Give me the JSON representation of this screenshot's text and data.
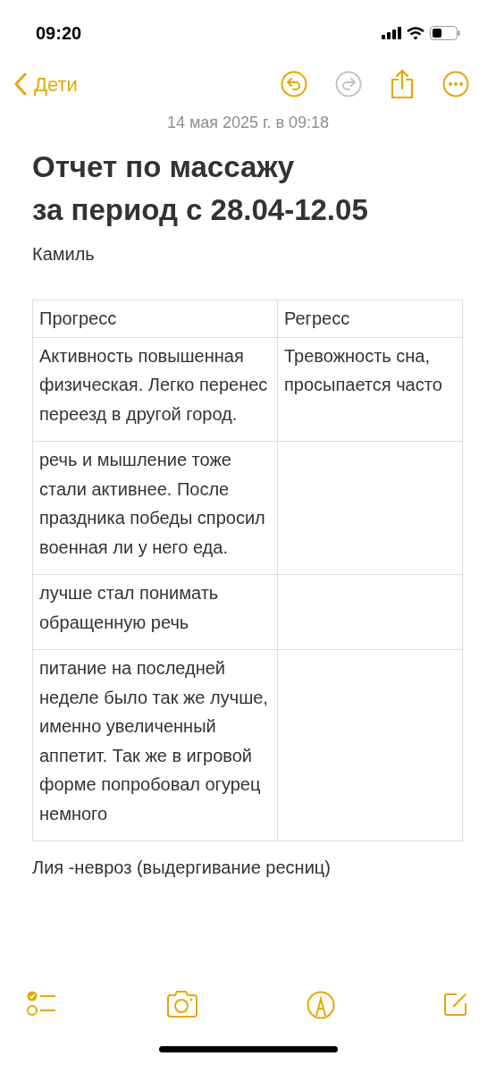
{
  "status_bar": {
    "time": "09:20"
  },
  "nav": {
    "back_label": "Дети",
    "redo_disabled": true
  },
  "note": {
    "date": "14 мая 2025 г. в 09:18",
    "title_lines": [
      "Отчет по массажу",
      "за период с 28.04-12.05"
    ],
    "subtitle": "Камиль",
    "table": {
      "columns": [
        "Прогресс",
        "Регресс"
      ],
      "rows": [
        [
          "Активность повышенная физическая. Легко перенес переезд в другой город.",
          "Тревожность сна, просыпается часто"
        ],
        [
          "речь и мышление тоже стали активнее. После праздника победы спросил военная ли у него еда.",
          ""
        ],
        [
          "лучше стал понимать обращенную речь",
          ""
        ],
        [
          "питание на последней неделе было так же лучше, именно увеличенный аппетит. Так же в игровой форме попробовал огурец немного",
          ""
        ]
      ]
    },
    "next_heading": "Лия -невроз (выдергивание ресниц)"
  }
}
